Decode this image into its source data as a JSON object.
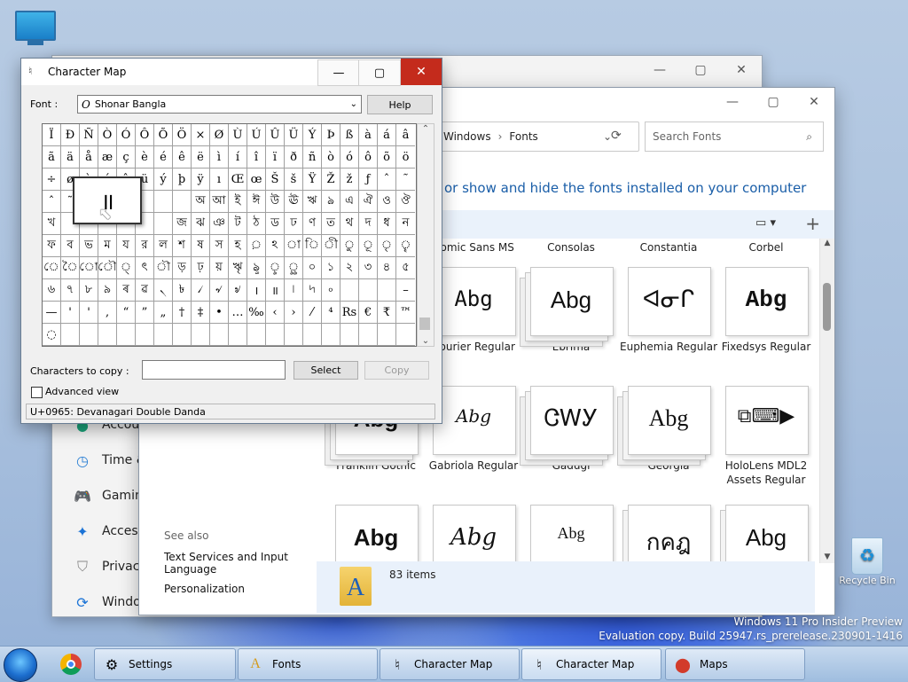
{
  "desktop": {
    "recycle_bin_label": "Recycle Bin",
    "watermark_line1": "Windows 11 Pro Insider Preview",
    "watermark_line2": "Evaluation copy. Build 25947.rs_prerelease.230901-1416"
  },
  "settings_window": {
    "nav_items": [
      {
        "label": "Accou",
        "icon": "account-icon"
      },
      {
        "label": "Time &",
        "icon": "clock-globe-icon"
      },
      {
        "label": "Gamin",
        "icon": "gamepad-icon"
      },
      {
        "label": "Access",
        "icon": "accessibility-icon"
      },
      {
        "label": "Privac",
        "icon": "shield-icon"
      },
      {
        "label": "Windo",
        "icon": "windows-update-icon"
      }
    ]
  },
  "fonts_window": {
    "breadcrumb": [
      "Windows",
      "Fonts"
    ],
    "search_placeholder": "Search Fonts",
    "heading": "or show and hide the fonts installed on your computer",
    "see_also": {
      "title": "See also",
      "links": [
        "Text Services and Input Language",
        "Personalization"
      ]
    },
    "status": "83 items",
    "top_labels": [
      "Comic Sans MS",
      "Consolas",
      "Constantia",
      "Corbel"
    ],
    "tiles_row1": [
      {
        "label": "Courier Regular",
        "sample": "Abg"
      },
      {
        "label": "Ebrima",
        "sample": "Abg"
      },
      {
        "label": "Euphemia Regular",
        "sample": "ᐊᓂᒋ"
      },
      {
        "label": "Fixedsys Regular",
        "sample": "Abg"
      }
    ],
    "tiles_row2": [
      {
        "label": "Franklin Gothic",
        "sample": "Abg"
      },
      {
        "label": "Gabriola Regular",
        "sample": "Abg"
      },
      {
        "label": "Gadugi",
        "sample": "ᏣᎳᎩ"
      },
      {
        "label": "Georgia",
        "sample": "Abg"
      },
      {
        "label": "HoloLens MDL2 Assets Regular",
        "sample": "⧉⌨▶"
      }
    ],
    "tiles_row3": [
      {
        "sample": "Abg"
      },
      {
        "sample": "Abg"
      },
      {
        "sample": "Abg"
      },
      {
        "sample": "กคฎ"
      },
      {
        "sample": "Abg"
      }
    ]
  },
  "charmap": {
    "title": "Character Map",
    "font_label": "Font :",
    "font_value": "Shonar Bangla",
    "help": "Help",
    "copy_label": "Characters to copy :",
    "copy_value": "",
    "select": "Select",
    "copy": "Copy",
    "advanced": "Advanced view",
    "status": "U+0965: Devanagari Double Danda",
    "zoom_char": "॥",
    "grid_rows": [
      [
        "Ï",
        "Ð",
        "Ñ",
        "Ò",
        "Ó",
        "Ô",
        "Õ",
        "Ö",
        "×",
        "Ø",
        "Ù",
        "Ú",
        "Û",
        "Ü",
        "Ý",
        "Þ",
        "ß",
        "à",
        "á",
        "â"
      ],
      [
        "ã",
        "ä",
        "å",
        "æ",
        "ç",
        "è",
        "é",
        "ê",
        "ë",
        "ì",
        "í",
        "î",
        "ï",
        "ð",
        "ñ",
        "ò",
        "ó",
        "ô",
        "õ",
        "ö"
      ],
      [
        "÷",
        "ø",
        "ù",
        "ú",
        "û",
        "ü",
        "ý",
        "þ",
        "ÿ",
        "ı",
        "Œ",
        "œ",
        "Š",
        "š",
        "Ÿ",
        "Ž",
        "ž",
        "ƒ",
        "ˆ",
        "˜"
      ],
      [
        "ˆ",
        "˜",
        "",
        "",
        "",
        "",
        "",
        "",
        "অ",
        "আ",
        "ই",
        "ঈ",
        "উ",
        "ঊ",
        "ঋ",
        "ঌ",
        "এ",
        "ঐ",
        "ও",
        "ঔ"
      ],
      [
        "খ",
        "",
        "",
        "",
        "",
        "",
        "",
        "জ",
        "ঝ",
        "ঞ",
        "ট",
        "ঠ",
        "ড",
        "ঢ",
        "ণ",
        "ত",
        "থ",
        "দ",
        "ধ",
        "ন",
        "প"
      ],
      [
        "ফ",
        "ব",
        "ভ",
        "ম",
        "য",
        "র",
        "ল",
        "শ",
        "ষ",
        "স",
        "হ",
        "়",
        "ঽ",
        "া",
        "ি",
        "ী",
        "ু",
        "ূ",
        "ৃ",
        "ৄ"
      ],
      [
        "ে",
        "ৈ",
        "ো",
        "ৌ",
        "্",
        "ৎ",
        "ৗ",
        "ড়",
        "ঢ়",
        "য়",
        "ৠ",
        "ৡ",
        "ৢ",
        "ৣ",
        "০",
        "১",
        "২",
        "৩",
        "৪",
        "৫"
      ],
      [
        "৬",
        "৭",
        "৮",
        "৯",
        "ৰ",
        "ৱ",
        "৲",
        "৳",
        "৴",
        "৵",
        "৶",
        "।",
        "॥",
        "৷",
        "৸",
        "৹",
        "",
        "",
        "",
        "–"
      ],
      [
        "—",
        "'",
        "'",
        "‚",
        "“",
        "”",
        "„",
        "†",
        "‡",
        "•",
        "…",
        "‰",
        "‹",
        "›",
        "⁄",
        "⁴",
        "Rs",
        "€",
        "₹",
        "™"
      ],
      [
        "◌",
        "",
        "",
        "",
        "",
        "",
        "",
        "",
        "",
        "",
        "",
        "",
        "",
        "",
        "",
        "",
        "",
        "",
        "",
        ""
      ]
    ]
  },
  "taskbar": {
    "items": [
      {
        "label": "Settings",
        "icon": "gear-icon"
      },
      {
        "label": "Fonts",
        "icon": "fonts-folder-icon"
      },
      {
        "label": "Character Map",
        "icon": "charmap-icon"
      },
      {
        "label": "Character Map",
        "icon": "charmap-icon"
      },
      {
        "label": "Maps",
        "icon": "map-pin-icon"
      }
    ]
  }
}
